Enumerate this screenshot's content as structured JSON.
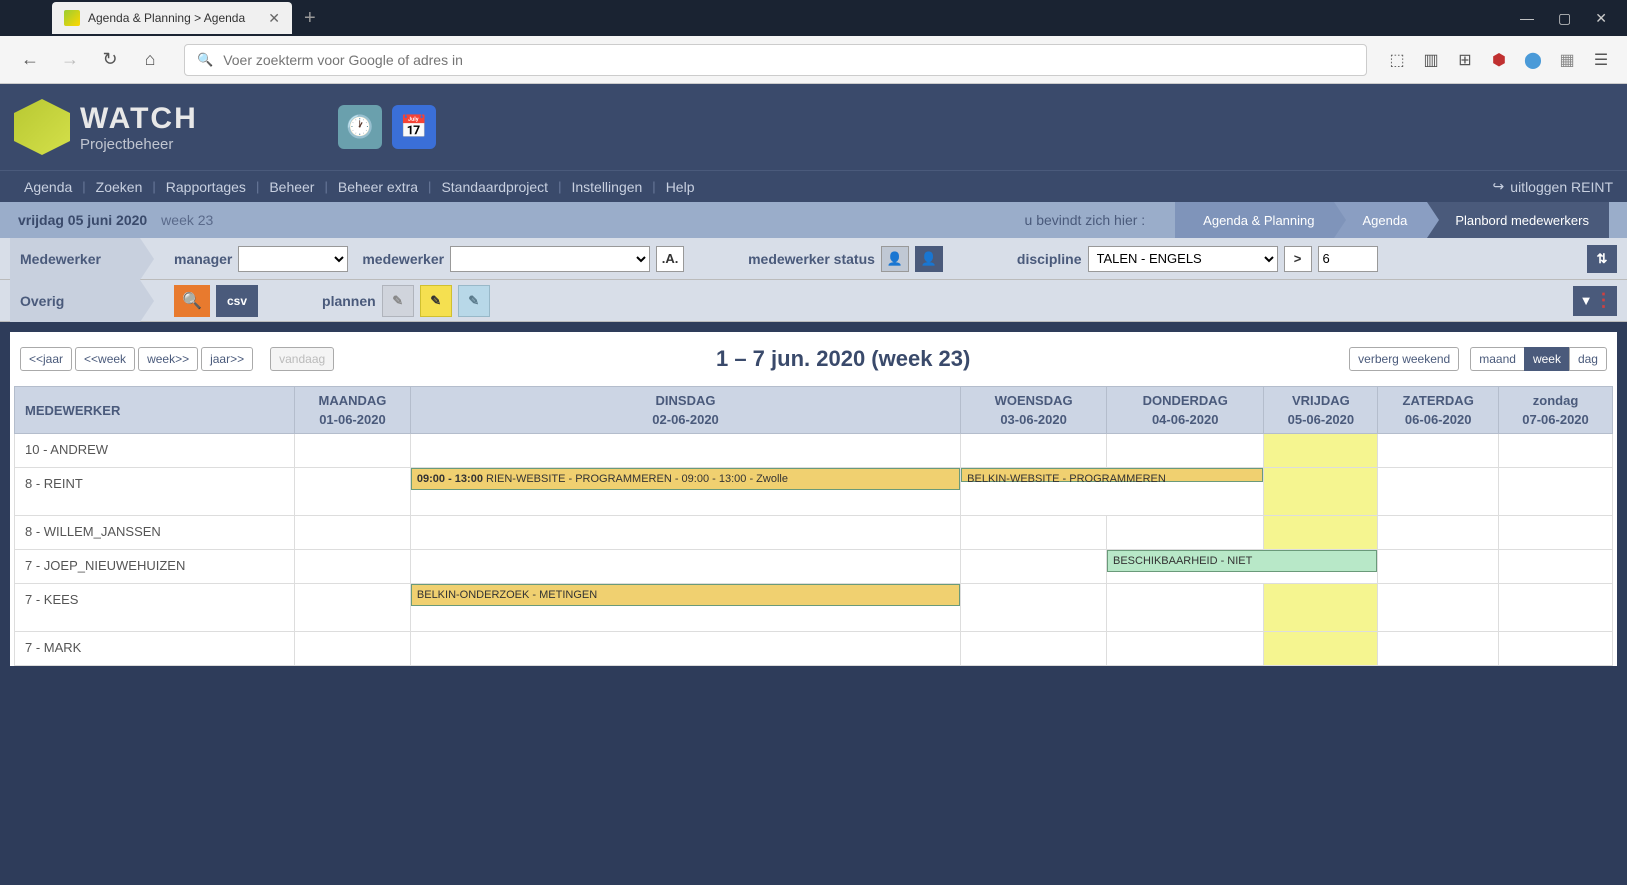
{
  "browser": {
    "tab_title": "Agenda & Planning > Agenda",
    "url_placeholder": "Voer zoekterm voor Google of adres in"
  },
  "app": {
    "logo_main": "WATCH",
    "logo_sub": "Projectbeheer",
    "nav": [
      "Agenda",
      "Zoeken",
      "Rapportages",
      "Beheer",
      "Beheer extra",
      "Standaardproject",
      "Instellingen",
      "Help"
    ],
    "logout": "uitloggen REINT"
  },
  "breadcrumb": {
    "date": "vrijdag 05 juni 2020",
    "week": "week 23",
    "loc": "u bevindt zich hier :",
    "crumbs": [
      "Agenda & Planning",
      "Agenda",
      "Planbord medewerkers"
    ]
  },
  "filter1": {
    "label": "Medewerker",
    "manager_label": "manager",
    "manager_value": "",
    "medewerker_label": "medewerker",
    "medewerker_value": "",
    "aa_btn": ".A.",
    "status_label": "medewerker status",
    "discipline_label": "discipline",
    "discipline_value": "TALEN - ENGELS",
    "gt": ">",
    "count": "6"
  },
  "filter2": {
    "label": "Overig",
    "csv": "csv",
    "plannen_label": "plannen"
  },
  "datenav": {
    "prev_year": "<<jaar",
    "prev_week": "<<week",
    "next_week": "week>>",
    "next_year": "jaar>>",
    "today": "vandaag",
    "title": "1 – 7 jun. 2020 (week 23)",
    "hide_weekend": "verberg weekend",
    "maand": "maand",
    "week": "week",
    "dag": "dag"
  },
  "table": {
    "mw_header": "MEDEWERKER",
    "days": [
      {
        "name": "MAANDAG",
        "date": "01-06-2020"
      },
      {
        "name": "DINSDAG",
        "date": "02-06-2020"
      },
      {
        "name": "WOENSDAG",
        "date": "03-06-2020"
      },
      {
        "name": "DONDERDAG",
        "date": "04-06-2020"
      },
      {
        "name": "VRIJDAG",
        "date": "05-06-2020"
      },
      {
        "name": "ZATERDAG",
        "date": "06-06-2020"
      },
      {
        "name": "zondag",
        "date": "07-06-2020"
      }
    ],
    "rows": [
      {
        "mw": "10 - ANDREW"
      },
      {
        "mw": "8 - REINT"
      },
      {
        "mw": "8 - WILLEM_JANSSEN"
      },
      {
        "mw": "7 - JOEP_NIEUWEHUIZEN"
      },
      {
        "mw": "7 - KEES"
      },
      {
        "mw": "7 - MARK"
      }
    ],
    "events": {
      "reint_dinsdag_time": "09:00 - 13:00",
      "reint_dinsdag_rest": " RIEN-WEBSITE - PROGRAMMEREN - 09:00 - 13:00 - Zwolle",
      "reint_woensdag": "BELKIN-WEBSITE - PROGRAMMEREN",
      "joep_do_vr": "BESCHIKBAARHEID - NIET",
      "kees_dinsdag": " BELKIN-ONDERZOEK - METINGEN"
    }
  }
}
